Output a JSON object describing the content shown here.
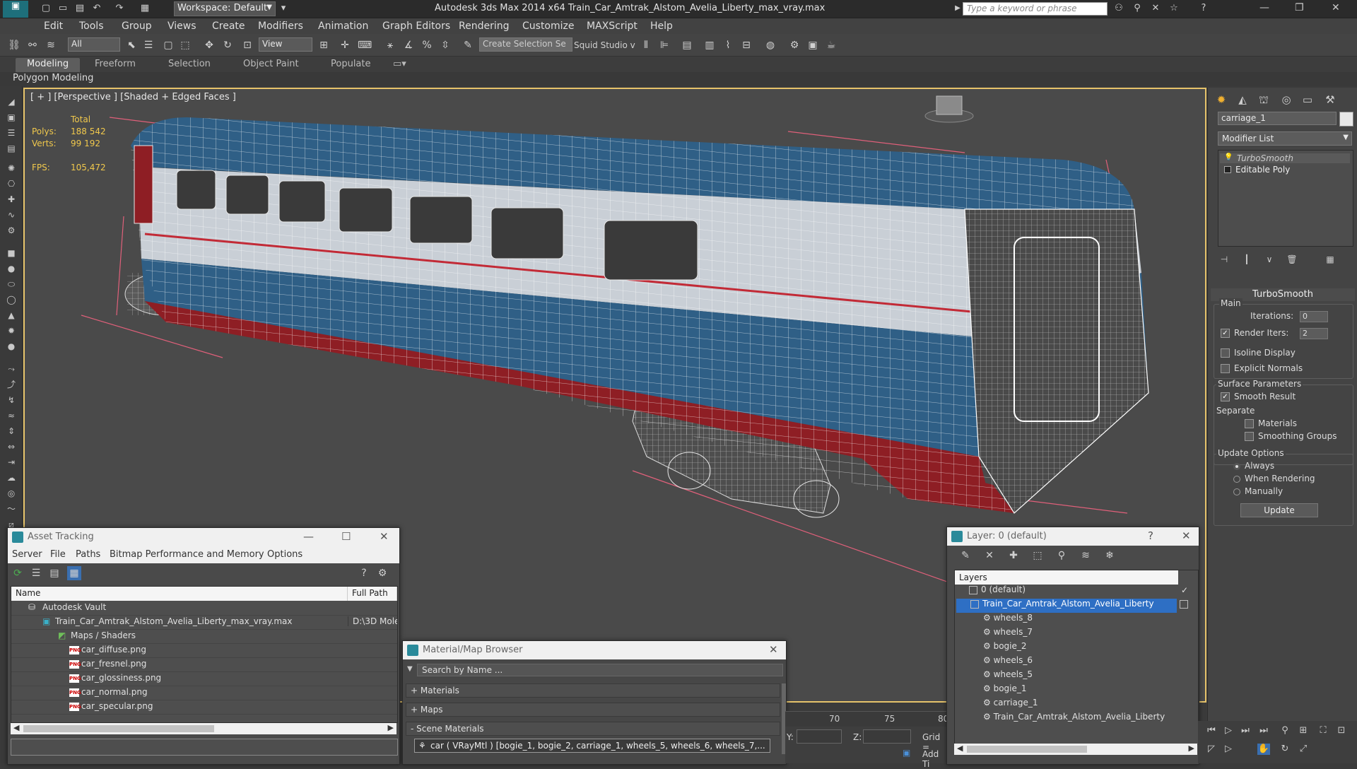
{
  "titlebar": {
    "app_title": "Autodesk 3ds Max  2014 x64     Train_Car_Amtrak_Alstom_Avelia_Liberty_max_vray.max",
    "workspace": "Workspace: Default",
    "search_placeholder": "Type a keyword or phrase"
  },
  "menubar": {
    "items": [
      "Edit",
      "Tools",
      "Group",
      "Views",
      "Create",
      "Modifiers",
      "Animation",
      "Graph Editors",
      "Rendering",
      "Customize",
      "MAXScript",
      "Help"
    ]
  },
  "maintoolbar": {
    "selection_filter": "All",
    "reference_coord": "View",
    "named_selection_placeholder": "Create Selection Se",
    "studio_label": "Squid Studio v"
  },
  "ribbon": {
    "tabs": [
      "Modeling",
      "Freeform",
      "Selection",
      "Object Paint",
      "Populate"
    ],
    "panel": "Polygon Modeling"
  },
  "viewport": {
    "label": "[ + ] [Perspective ] [Shaded + Edged Faces ]",
    "stats": {
      "total_label": "Total",
      "polys_label": "Polys:",
      "polys_value": "188 542",
      "verts_label": "Verts:",
      "verts_value": "99 192",
      "fps_label": "FPS:",
      "fps_value": "105,472"
    },
    "colors": {
      "blue": "#2f5f86",
      "white": "#c9cfd6",
      "red": "#8e1e24",
      "wire": "#ffffff",
      "border": "#e6c36a"
    }
  },
  "commandpanel": {
    "object_name": "carriage_1",
    "modifier_list": "Modifier List",
    "stack": [
      "TurboSmooth",
      "Editable Poly"
    ],
    "rollout": "TurboSmooth",
    "main_label": "Main",
    "iterations_label": "Iterations:",
    "iterations_value": "0",
    "render_iters_label": "Render Iters:",
    "render_iters_value": "2",
    "isoline": "Isoline Display",
    "explicit_normals": "Explicit Normals",
    "surface_params": "Surface Parameters",
    "smooth_result": "Smooth Result",
    "separate": "Separate",
    "materials": "Materials",
    "smoothing_groups": "Smoothing Groups",
    "update_options": "Update Options",
    "always": "Always",
    "when_rendering": "When Rendering",
    "manually": "Manually",
    "update_button": "Update"
  },
  "asset_tracking": {
    "title": "Asset Tracking",
    "menu": [
      "Server",
      "File",
      "Paths",
      "Bitmap Performance and Memory",
      "Options"
    ],
    "columns": [
      "Name",
      "Full Path"
    ],
    "rows": [
      {
        "name": "Autodesk Vault",
        "path": ""
      },
      {
        "name": "Train_Car_Amtrak_Alstom_Avelia_Liberty_max_vray.max",
        "path": "D:\\3D Mole"
      },
      {
        "name": "Maps / Shaders",
        "path": ""
      },
      {
        "name": "car_diffuse.png",
        "path": ""
      },
      {
        "name": "car_fresnel.png",
        "path": ""
      },
      {
        "name": "car_glossiness.png",
        "path": ""
      },
      {
        "name": "car_normal.png",
        "path": ""
      },
      {
        "name": "car_specular.png",
        "path": ""
      }
    ],
    "png_badge": "PNG"
  },
  "material_browser": {
    "title": "Material/Map Browser",
    "search_placeholder": "Search by Name ...",
    "sections": [
      "+ Materials",
      "+ Maps",
      "- Scene Materials"
    ],
    "scene_material": "car  ( VRayMtl )  [bogie_1, bogie_2, carriage_1, wheels_5, wheels_6, wheels_7,..."
  },
  "layer_window": {
    "title": "Layer: 0 (default)",
    "header": "Layers",
    "rows": [
      {
        "label": "0 (default)",
        "indent": 0
      },
      {
        "label": "Train_Car_Amtrak_Alstom_Avelia_Liberty",
        "indent": 0
      },
      {
        "label": "wheels_8",
        "indent": 1
      },
      {
        "label": "wheels_7",
        "indent": 1
      },
      {
        "label": "bogie_2",
        "indent": 1
      },
      {
        "label": "wheels_6",
        "indent": 1
      },
      {
        "label": "wheels_5",
        "indent": 1
      },
      {
        "label": "bogie_1",
        "indent": 1
      },
      {
        "label": "carriage_1",
        "indent": 1
      },
      {
        "label": "Train_Car_Amtrak_Alstom_Avelia_Liberty",
        "indent": 1
      }
    ],
    "selected_index": 1
  },
  "timeline": {
    "ticks": [
      "70",
      "75",
      "80"
    ],
    "y_label": "Y:",
    "z_label": "Z:",
    "grid_label": "Grid =",
    "add_time_tag": "Add Ti"
  }
}
